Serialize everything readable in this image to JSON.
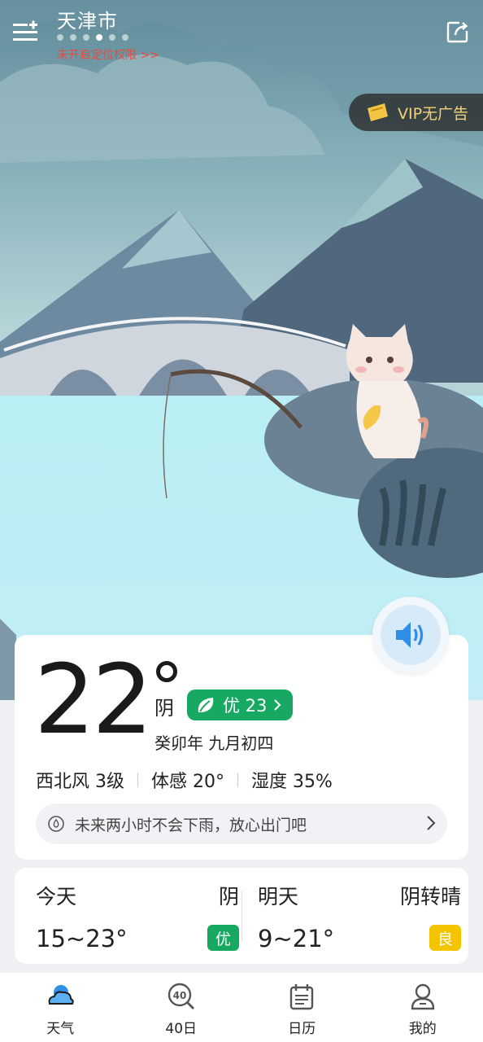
{
  "header": {
    "city": "天津市",
    "location_prompt": "未开启定位权限 >>",
    "page_dots": 6,
    "active_dot": 3
  },
  "vip": {
    "label": "VIP无广告"
  },
  "current": {
    "temperature": "22",
    "condition": "阴",
    "aqi_label": "优 23",
    "lunar_date": "癸卯年 九月初四",
    "wind": "西北风 3级",
    "feels_like": "体感 20°",
    "humidity": "湿度 35%",
    "rain_forecast": "未来两小时不会下雨，放心出门吧"
  },
  "forecast": [
    {
      "day": "今天",
      "condition": "阴",
      "range": "15~23°",
      "aqi": "优",
      "aqi_color": "#17a861"
    },
    {
      "day": "明天",
      "condition": "阴转晴",
      "range": "9~21°",
      "aqi": "良",
      "aqi_color": "#f5c400"
    }
  ],
  "nav": [
    {
      "label": "天气",
      "icon": "cloud-weather-icon",
      "active": true
    },
    {
      "label": "40日",
      "icon": "40-day-search-icon",
      "active": false
    },
    {
      "label": "日历",
      "icon": "calendar-icon",
      "active": false
    },
    {
      "label": "我的",
      "icon": "profile-icon",
      "active": false
    }
  ],
  "colors": {
    "accent_green": "#17a861",
    "accent_yellow": "#f5c400",
    "alert_red": "#e84a3d",
    "vip_gold": "#f4d27a"
  }
}
